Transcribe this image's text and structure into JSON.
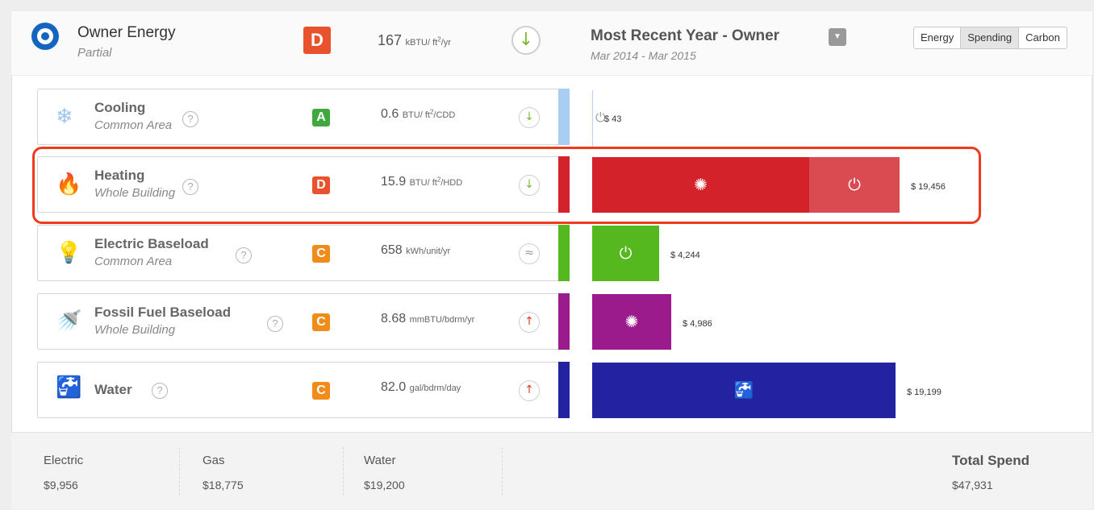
{
  "header": {
    "title": "Owner Energy",
    "subtitle": "Partial",
    "grade": "D",
    "grade_color": "#e8532d",
    "value": "167",
    "unit_prefix": "kBTU/ ft",
    "unit_sup": "2",
    "unit_suffix": "/yr",
    "trend_icon": "arrow-down-icon",
    "trend_glyph": "↓",
    "period_title": "Most Recent Year - Owner",
    "period_range": "Mar 2014 - Mar 2015",
    "toggles": [
      "Energy",
      "Spending",
      "Carbon"
    ],
    "active_toggle": "Spending"
  },
  "rows": [
    {
      "label": "Cooling",
      "sub": "Common Area",
      "help": "?",
      "icon": "snowflake-icon",
      "icon_glyph": "❄",
      "icon_color": "#9cc6ef",
      "grade": "A",
      "grade_color": "#3fa93f",
      "value": "0.6",
      "unit_prefix": "BTU/ ft",
      "unit_sup": "2",
      "unit_suffix": "/CDD",
      "trend": "down",
      "trend_glyph": "↓",
      "trend_color": "#7ab82c",
      "bar_color": "#aacdf2",
      "amount": "$ 43",
      "segments": [
        {
          "fraction": 0.0,
          "color": "#aacdf2",
          "icon": "plug-icon",
          "glyph": "⏻"
        }
      ]
    },
    {
      "label": "Heating",
      "sub": "Whole Building",
      "help": "?",
      "icon": "flame-icon",
      "icon_glyph": "🔥",
      "icon_color": "#d9232d",
      "grade": "D",
      "grade_color": "#e8532d",
      "value": "15.9",
      "unit_prefix": "BTU/ ft",
      "unit_sup": "2",
      "unit_suffix": "/HDD",
      "trend": "down",
      "trend_glyph": "↓",
      "trend_color": "#7ab82c",
      "bar_color": "#d32229",
      "amount": "$ 19,456",
      "segments": [
        {
          "fraction": 0.705,
          "color": "#d32229",
          "icon": "gas-burst-icon",
          "glyph": "✺"
        },
        {
          "fraction": 0.295,
          "color": "#da4a51",
          "icon": "plug-icon",
          "glyph": "⏻"
        }
      ]
    },
    {
      "label": "Electric Baseload",
      "sub": "Common Area",
      "help": "?",
      "icon": "lightbulb-icon",
      "icon_glyph": "💡",
      "icon_color": "#55b81f",
      "grade": "C",
      "grade_color": "#f08c1a",
      "value": "658",
      "unit_prefix": "kWh/unit/yr",
      "unit_sup": "",
      "unit_suffix": "",
      "trend": "flat",
      "trend_glyph": "≈",
      "trend_color": "#999999",
      "bar_color": "#55b81f",
      "amount": "$ 4,244",
      "segments": [
        {
          "fraction": 1.0,
          "color": "#55b81f",
          "icon": "plug-icon",
          "glyph": "⏻"
        }
      ]
    },
    {
      "label": "Fossil Fuel Baseload",
      "sub": "Whole Building",
      "help": "?",
      "icon": "shower-icon",
      "icon_glyph": "🚿",
      "icon_color": "#9b1a8c",
      "grade": "C",
      "grade_color": "#f08c1a",
      "value": "8.68",
      "unit_prefix": "mmBTU/bdrm/yr",
      "unit_sup": "",
      "unit_suffix": "",
      "trend": "up",
      "trend_glyph": "↑",
      "trend_color": "#e23b20",
      "bar_color": "#9b1a8c",
      "amount": "$ 4,986",
      "segments": [
        {
          "fraction": 1.0,
          "color": "#9b1a8c",
          "icon": "gas-burst-icon",
          "glyph": "✺"
        }
      ]
    },
    {
      "label": "Water",
      "sub": "",
      "help": "?",
      "icon": "faucet-icon",
      "icon_glyph": "🚰",
      "icon_color": "#2b2fa6",
      "grade": "C",
      "grade_color": "#f08c1a",
      "value": "82.0",
      "unit_prefix": "gal/bdrm/day",
      "unit_sup": "",
      "unit_suffix": "",
      "trend": "up",
      "trend_glyph": "↑",
      "trend_color": "#e23b20",
      "bar_color": "#2323a2",
      "amount": "$ 19,199",
      "segments": [
        {
          "fraction": 1.0,
          "color": "#2323a2",
          "icon": "faucet-icon",
          "glyph": "🚰"
        }
      ]
    }
  ],
  "footer": {
    "electric_label": "Electric",
    "electric_value": "$9,956",
    "gas_label": "Gas",
    "gas_value": "$18,775",
    "water_label": "Water",
    "water_value": "$19,200",
    "total_label": "Total Spend",
    "total_value": "$47,931"
  },
  "chart_data": {
    "type": "bar",
    "categories": [
      "Cooling",
      "Heating",
      "Electric Baseload",
      "Fossil Fuel Baseload",
      "Water"
    ],
    "values": [
      43,
      19456,
      4244,
      4986,
      19199
    ],
    "xlim": [
      0,
      19456
    ]
  },
  "colors": {
    "highlight": "#f03a1b",
    "brand": "#1565c0"
  }
}
